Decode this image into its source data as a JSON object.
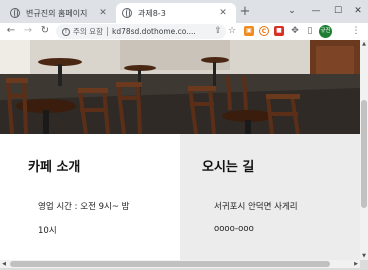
{
  "tabs": [
    {
      "title": "변규진의 홈페이지",
      "active": false
    },
    {
      "title": "과제8-3",
      "active": true
    }
  ],
  "window_controls": {
    "caret": "⌄",
    "minimize": "—",
    "maximize": "☐",
    "close": "✕"
  },
  "new_tab_label": "+",
  "toolbar": {
    "back": "←",
    "forward": "→",
    "reload": "↻",
    "security_warning": "!",
    "security_label": "주의 요함",
    "url": "kd78sd.dothome.co....",
    "share_icon": "⇪",
    "bookmark_icon": "☆",
    "extensions": [
      {
        "name": "ext-orange",
        "label": "▣",
        "color": "#f28b1e"
      },
      {
        "name": "ext-c",
        "label": "C",
        "color": "#e8710a"
      },
      {
        "name": "ext-red",
        "label": "■",
        "color": "#d93025"
      }
    ],
    "puzzle_icon": "✥",
    "sidepanel_icon": "▯",
    "profile_label": "규진",
    "menu_icon": "⋮"
  },
  "hero": {
    "floor_color": "#3e3832",
    "wall_color": "#d9d4cc",
    "furniture_color": "#5a2e17"
  },
  "sections": {
    "intro": {
      "title": "카페 소개",
      "line1": "영업 시간 : 오전 9시~ 밤",
      "line2": "10시"
    },
    "location": {
      "title": "오시는 길",
      "line1": "서귀포시 안덕면 사게리",
      "line2": "oooo-ooo"
    }
  },
  "scroll": {
    "up": "▲",
    "down": "▼",
    "left": "◀",
    "right": "▶"
  }
}
